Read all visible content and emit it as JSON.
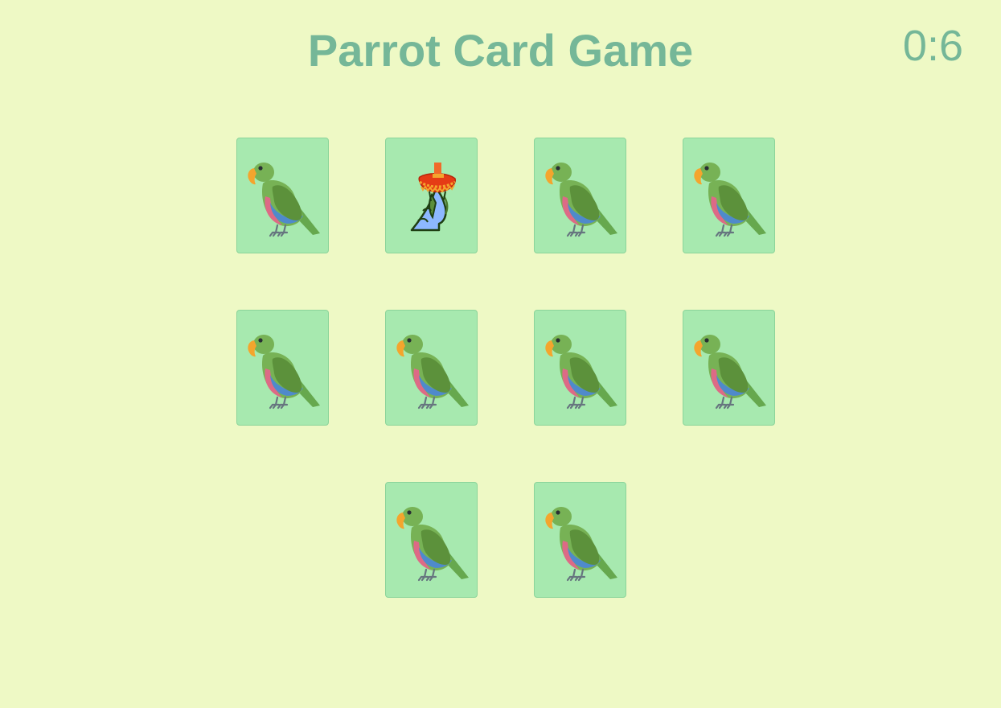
{
  "header": {
    "title": "Parrot Card Game",
    "timer": "0:6"
  },
  "colors": {
    "background": "#EEF9C5",
    "title": "#75B798",
    "card_face": "#A7E9AF",
    "card_border": "#8BD49A"
  },
  "cards": [
    {
      "state": "face-down",
      "icon": "parrot-icon"
    },
    {
      "state": "face-up",
      "icon": "sombrero-parrot-icon"
    },
    {
      "state": "face-down",
      "icon": "parrot-icon"
    },
    {
      "state": "face-down",
      "icon": "parrot-icon"
    },
    {
      "state": "face-down",
      "icon": "parrot-icon"
    },
    {
      "state": "face-down",
      "icon": "parrot-icon"
    },
    {
      "state": "face-down",
      "icon": "parrot-icon"
    },
    {
      "state": "face-down",
      "icon": "parrot-icon"
    },
    {
      "state": "face-down",
      "icon": "parrot-icon"
    },
    {
      "state": "face-down",
      "icon": "parrot-icon"
    }
  ]
}
